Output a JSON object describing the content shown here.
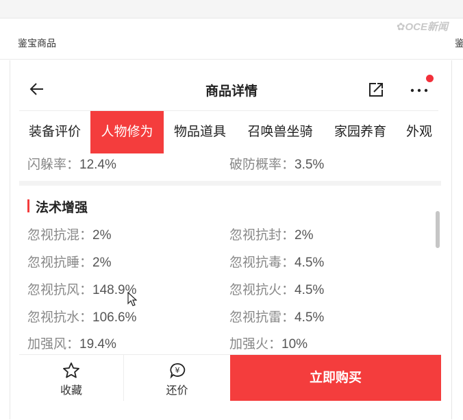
{
  "crumb": "鉴宝商品",
  "crumb_right": "鉴",
  "watermark": "✿OCE新闻",
  "header": {
    "title": "商品详情"
  },
  "tabs": [
    "装备评价",
    "人物修为",
    "物品道具",
    "召唤兽坐骑",
    "家园养育",
    "外观"
  ],
  "active_tab": "人物修为",
  "top_row": {
    "left_label": "闪躲率：",
    "left_value": "12.4%",
    "right_label": "破防概率：",
    "right_value": "3.5%"
  },
  "section_title": "法术增强",
  "stats": [
    {
      "left_label": "忽视抗混：",
      "left_value": "2%",
      "right_label": "忽视抗封：",
      "right_value": "2%"
    },
    {
      "left_label": "忽视抗睡：",
      "left_value": "2%",
      "right_label": "忽视抗毒：",
      "right_value": "4.5%"
    },
    {
      "left_label": "忽视抗风：",
      "left_value": "148.9%",
      "right_label": "忽视抗火：",
      "right_value": "4.5%"
    },
    {
      "left_label": "忽视抗水：",
      "left_value": "106.6%",
      "right_label": "忽视抗雷：",
      "right_value": "4.5%"
    },
    {
      "left_label": "加强风：",
      "left_value": "19.4%",
      "right_label": "加强火：",
      "right_value": "10%"
    }
  ],
  "bottom": {
    "favorite": "收藏",
    "counter_offer": "还价",
    "buy": "立即购买",
    "counter_icon_text": "¥"
  },
  "colors": {
    "accent": "#f43d3d",
    "notice_dot": "#f2303a"
  },
  "icons": [
    "back-arrow-icon",
    "share-icon",
    "more-dots-icon",
    "star-icon",
    "price-bubble-icon",
    "mouse-cursor-icon"
  ]
}
